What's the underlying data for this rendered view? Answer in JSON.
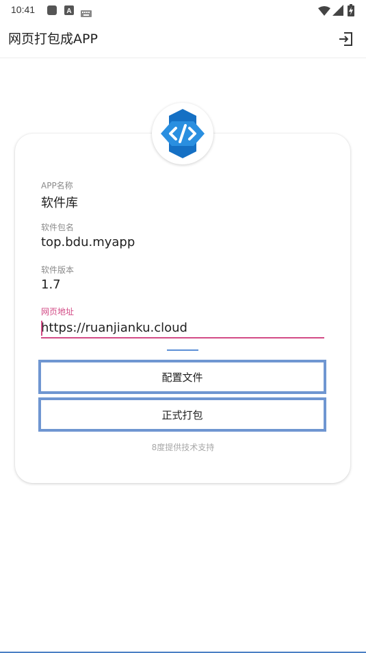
{
  "status_bar": {
    "time": "10:41",
    "icons": [
      "app-square-icon",
      "a-badge-icon",
      "keyboard-icon",
      "wifi-icon",
      "signal-icon",
      "battery-icon"
    ]
  },
  "app_bar": {
    "title": "网页打包成APP",
    "action_icon": "export-icon"
  },
  "logo": {
    "icon": "code-hexagon-icon",
    "accent": "#1e7fd6"
  },
  "form": {
    "app_name_label": "APP名称",
    "app_name_value": "软件库",
    "package_label": "软件包名",
    "package_value": "top.bdu.myapp",
    "version_label": "软件版本",
    "version_value": "1.7",
    "url_label": "网页地址",
    "url_value": "https://ruanjianku.cloud"
  },
  "buttons": {
    "config_label": "配置文件",
    "build_label": "正式打包"
  },
  "footer": {
    "support_text": "8度提供技术支持"
  },
  "colors": {
    "focus": "#d24a85",
    "button_border": "#6f96d1",
    "label": "#8a8a8a"
  }
}
